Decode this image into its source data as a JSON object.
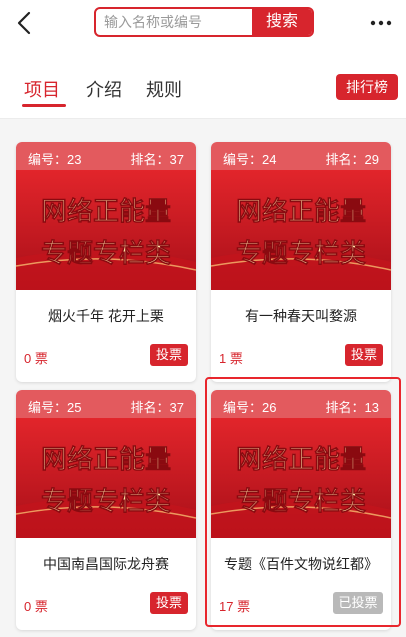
{
  "search": {
    "placeholder": "输入名称或编号",
    "button_label": "搜索"
  },
  "tabs": [
    {
      "label": "项目",
      "active": true
    },
    {
      "label": "介绍",
      "active": false
    },
    {
      "label": "规则",
      "active": false
    }
  ],
  "rank_button_label": "排行榜",
  "banner": {
    "line1": "网络正能量",
    "line2": "专题专栏类"
  },
  "cards": [
    {
      "num_label": "编号：23",
      "rank_label": "排名：37",
      "title": "烟火千年 花开上栗",
      "votes": "0 票",
      "button": "投票",
      "voted": false
    },
    {
      "num_label": "编号：24",
      "rank_label": "排名：29",
      "title": "有一种春天叫婺源",
      "votes": "1 票",
      "button": "投票",
      "voted": false
    },
    {
      "num_label": "编号：25",
      "rank_label": "排名：37",
      "title": "中国南昌国际龙舟赛",
      "votes": "0 票",
      "button": "投票",
      "voted": false
    },
    {
      "num_label": "编号：26",
      "rank_label": "排名：13",
      "title": "专题《百件文物说红都》",
      "votes": "17 票",
      "button": "已投票",
      "voted": true
    }
  ],
  "colors": {
    "accent": "#d7252d",
    "card_header": "#e35a5e",
    "voted_button": "#b9b9b9"
  }
}
